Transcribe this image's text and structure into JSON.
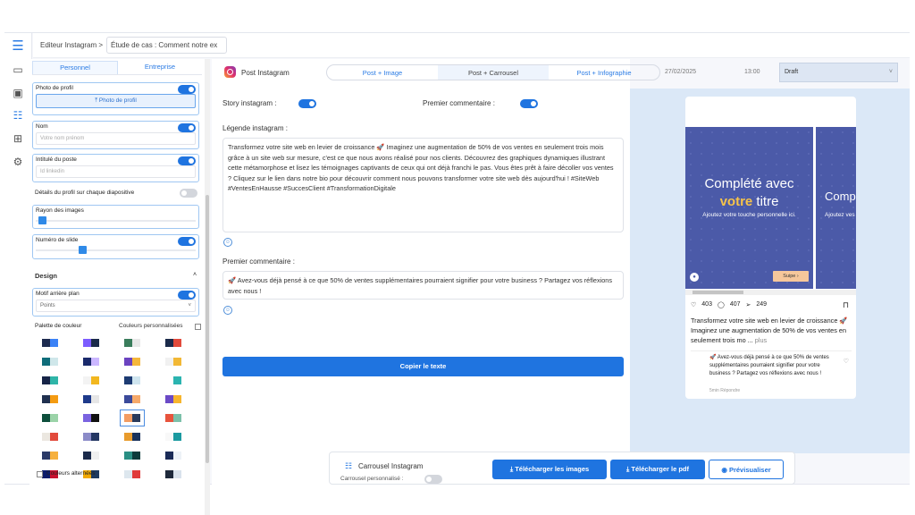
{
  "breadcrumb": {
    "root": "Editeur Instagram >",
    "current": "Étude de cas : Comment notre ex"
  },
  "left_panel": {
    "tabs": [
      "Personnel",
      "Entreprise"
    ],
    "photo_label": "Photo de profil",
    "photo_button": "Photo de profil",
    "name_label": "Nom",
    "name_placeholder": "Votre nom prénom",
    "job_label": "Intitulé du poste",
    "job_placeholder": "Id linkedin",
    "details_label": "Détails du profil sur chaque diapositive",
    "radius_label": "Rayon des images",
    "radius_value": 0.02,
    "slide_num_label": "Numéro de slide",
    "slide_num_value": 0.28,
    "design_label": "Design",
    "motif_label": "Motif arrière plan",
    "motif_value": "Points",
    "palette_label": "Palette de couleur",
    "custom_colors_label": "Couleurs personnalisées",
    "alt_colors_label": "Couleurs alternées",
    "palettes": [
      [
        "#1d2b4f",
        "#3b82f6"
      ],
      [
        "#7c5cff",
        "#1a2a4a"
      ],
      [
        "#3a7d5c",
        "#e8e8e8"
      ],
      [
        "#1b2a4a",
        "#e24a3b"
      ],
      [
        "#0f6d7a",
        "#cfe7ea"
      ],
      [
        "#1a2a6c",
        "#cbb7ff"
      ],
      [
        "#6b43c0",
        "#f5b73b"
      ],
      [
        "#f1f1f1",
        "#f2b835"
      ],
      [
        "#162447",
        "#2fb5a8"
      ],
      [
        "#f3f3f3",
        "#f2b71f"
      ],
      [
        "#1d3b72",
        "#cfe5ef"
      ],
      [
        "#ffffff",
        "#2bb4b0"
      ],
      [
        "#20304f",
        "#f49b12"
      ],
      [
        "#1e3a8a",
        "#e6e6e6"
      ],
      [
        "#3b4a9a",
        "#f6a96a"
      ],
      [
        "#6b4ac6",
        "#f7b52d"
      ],
      [
        "#0d4f3c",
        "#9bd3a8"
      ],
      [
        "#7a63e0",
        "#111111"
      ],
      [
        "#f39c61",
        "#2a3b5c"
      ],
      [
        "#e8533c",
        "#7cc0aa"
      ],
      [
        "#ebe7e0",
        "#e24a3b"
      ],
      [
        "#8b8bc8",
        "#243763"
      ],
      [
        "#e89b2c",
        "#19325c"
      ],
      [
        "#f8f8f8",
        "#1b9aa0"
      ],
      [
        "#2b3a67",
        "#f6b03d"
      ],
      [
        "#1b2b4b",
        "#f0f0f0"
      ],
      [
        "#2a8f84",
        "#0b3b3b"
      ],
      [
        "#1a2b57",
        "#edf2f7"
      ],
      [
        "#0b1b6b",
        "#c8102e"
      ],
      [
        "#f2a900",
        "#1e3a5f"
      ],
      [
        "#dde7ee",
        "#e03a3a"
      ],
      [
        "#1e293b",
        "#d9e2ec"
      ]
    ]
  },
  "header": {
    "title": "Post Instagram",
    "tabs": [
      "Post + Image",
      "Post + Carrousel",
      "Post + Infographie"
    ],
    "date": "27/02/2025",
    "time": "13:00",
    "status": "Draft"
  },
  "editor": {
    "story_label": "Story instagram :",
    "first_comment_toggle_label": "Premier commentaire :",
    "caption_label": "Légende instagram :",
    "caption": "Transformez votre site web en levier de croissance 🚀 Imaginez une augmentation de 50% de vos ventes en seulement trois mois grâce à un site web sur mesure, c'est ce que nous avons réalisé pour nos clients. Découvrez des graphiques dynamiques illustrant cette métamorphose et lisez les témoignages captivants de ceux qui ont déjà franchi le pas. Vous êtes prêt à faire décoller vos ventes ? Cliquez sur le lien dans notre bio pour découvrir comment nous pouvons transformer votre site web dès aujourd'hui ! #SiteWeb #VentesEnHausse #SuccesClient #TransformationDigitale",
    "comment_label": "Premier commentaire :",
    "comment": "🚀 Avez-vous déjà pensé à ce que 50% de ventes supplémentaires pourraient signifier pour votre business ? Partagez vos réflexions avec nous !",
    "copy_button": "Copier le texte"
  },
  "preview": {
    "slide_title_1": "Complété avec",
    "slide_title_2": "votre titre",
    "slide_sub": "Ajoutez votre touche personnelle ici.",
    "slide_sub_strong": "votre",
    "next_btn": "Suipe  ›",
    "slide2_title": "Comp",
    "slide2_sub": "Ajoutez ves",
    "likes": "403",
    "comments": "407",
    "shares": "249",
    "caption_preview": "Transformez votre site web en levier de croissance 🚀 Imaginez une augmentation de 50% de vos ventes en seulement trois mo ...",
    "more": "plus",
    "comment_preview": "🚀 Avez-vous déjà pensé à ce que 50% de ventes supplémentaires pourraient signifier pour votre business ? Partagez vos réflexions avec nous !",
    "comment_meta": "5min    Répondre",
    "accent": "#4b5aa8",
    "btn_color": "#f6c79b"
  },
  "footer": {
    "title": "Carrousel Instagram",
    "sub": "Carrousel personnalisé :",
    "btn_images": "Télécharger les images",
    "btn_pdf": "Télécharger le pdf",
    "btn_preview": "Prévisualiser"
  }
}
